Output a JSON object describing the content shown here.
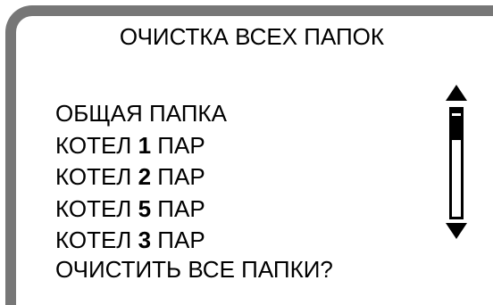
{
  "screen": {
    "title": "ОЧИСТКА ВСЕХ ПАПОК",
    "items": [
      {
        "prefix": "ОБЩАЯ ПАПКА",
        "number": "",
        "suffix": ""
      },
      {
        "prefix": "КОТЕЛ ",
        "number": "1",
        "suffix": " ПАР"
      },
      {
        "prefix": "КОТЕЛ ",
        "number": "2",
        "suffix": " ПАР"
      },
      {
        "prefix": "КОТЕЛ ",
        "number": "5",
        "suffix": " ПАР"
      },
      {
        "prefix": "КОТЕЛ ",
        "number": "3",
        "suffix": " ПАР"
      }
    ],
    "prompt": "ОЧИСТИТЬ ВСЕ ПАПКИ?"
  },
  "scrollbar": {
    "up_icon": "triangle-up-icon",
    "down_icon": "triangle-down-icon",
    "position": 0
  },
  "colors": {
    "frame": "#777777",
    "foreground": "#000000",
    "background": "#ffffff"
  }
}
